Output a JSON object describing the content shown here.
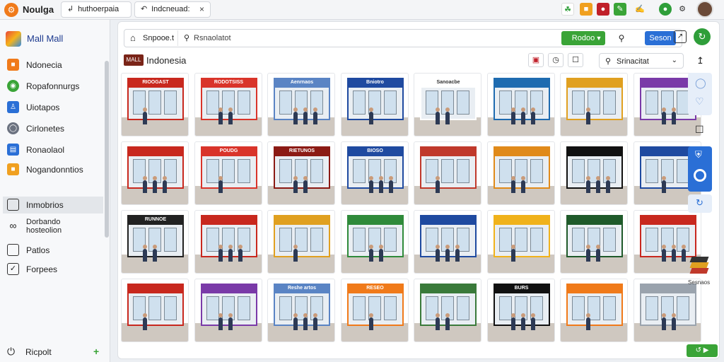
{
  "app": {
    "name": "Noulga"
  },
  "tabs": [
    {
      "label": "huthoerpaia"
    },
    {
      "label": "Indcneuad:"
    }
  ],
  "toolbar_icons": [
    {
      "icon": "leaf-icon",
      "color": "#2f9e3a"
    },
    {
      "icon": "square-icon",
      "color": "#f0a020"
    },
    {
      "icon": "record-icon",
      "color": "#c0202a"
    },
    {
      "icon": "edit-icon",
      "color": "#3aa437"
    },
    {
      "icon": "pen-icon",
      "color": "#333333"
    },
    {
      "icon": "chat-icon",
      "color": "#2f9e3a"
    },
    {
      "icon": "settings-icon",
      "color": "#333333"
    }
  ],
  "sidebar": {
    "header": "Mall Mall",
    "items": [
      {
        "label": "Ndonecia",
        "icon": "orange-square-icon",
        "color": "#f07a1a"
      },
      {
        "label": "Ropafonnurgs",
        "icon": "globe-icon",
        "color": "#3aa437"
      },
      {
        "label": "Uiotapos",
        "icon": "user-icon",
        "color": "#2a6fd6"
      },
      {
        "label": "Cirlonetes",
        "icon": "circle-icon",
        "color": "#6b7280"
      },
      {
        "label": "Ronaolaol",
        "icon": "id-card-icon",
        "color": "#2a6fd6"
      },
      {
        "label": "Nogandonntios",
        "icon": "folder-icon",
        "color": "#f0a020"
      }
    ],
    "items2": [
      {
        "label": "Inmobrios",
        "icon": "monitor-icon"
      },
      {
        "label": "Dorbando\nhosteolion",
        "icon": "link-icon"
      },
      {
        "label": "Patlos",
        "icon": "page-icon"
      },
      {
        "label": "Forpees",
        "icon": "check-box-icon"
      }
    ],
    "footer": "Ricpolt",
    "footer_action": "+"
  },
  "main": {
    "breadcrumb": "Snpooe.t",
    "search_text": "Rsnaolatot",
    "green_button": "Rodoo",
    "blue_button": "Seson",
    "flag_text": "MALL",
    "title": "Indonesia",
    "dropdown_text": "Srinacitat",
    "right_rail_label": "Sesnaos"
  },
  "tiles": [
    {
      "sign": "RIOOGAST",
      "color": "#c8281e"
    },
    {
      "sign": "RODOTSISS",
      "color": "#d9342a"
    },
    {
      "sign": "Aenrnaos",
      "color": "#5a84c4"
    },
    {
      "sign": "Bniotro",
      "color": "#1f4aa0"
    },
    {
      "sign": "Sanoacbe",
      "color": "#ffffff"
    },
    {
      "sign": "",
      "color": "#1e6bb0"
    },
    {
      "sign": "",
      "color": "#e0a020"
    },
    {
      "sign": "",
      "color": "#7a3aa8"
    },
    {
      "sign": "",
      "color": "#c8281e"
    },
    {
      "sign": "POUDG",
      "color": "#d9342a"
    },
    {
      "sign": "RIETUNOS",
      "color": "#8b1a14"
    },
    {
      "sign": "BIOSO",
      "color": "#1f4aa0"
    },
    {
      "sign": "",
      "color": "#c0392b"
    },
    {
      "sign": "",
      "color": "#e08a1a"
    },
    {
      "sign": "",
      "color": "#111111"
    },
    {
      "sign": "",
      "color": "#1f4aa0"
    },
    {
      "sign": "RUNNOE",
      "color": "#222222"
    },
    {
      "sign": "",
      "color": "#c8281e"
    },
    {
      "sign": "",
      "color": "#e0a020"
    },
    {
      "sign": "",
      "color": "#2f8a3a"
    },
    {
      "sign": "",
      "color": "#1f4aa0"
    },
    {
      "sign": "",
      "color": "#f0b21b"
    },
    {
      "sign": "",
      "color": "#1f5a2a"
    },
    {
      "sign": "",
      "color": "#c8281e"
    },
    {
      "sign": "",
      "color": "#c8281e"
    },
    {
      "sign": "",
      "color": "#7a3aa8"
    },
    {
      "sign": "Reshe artos",
      "color": "#5a84c4"
    },
    {
      "sign": "RESEO",
      "color": "#f07a1a"
    },
    {
      "sign": "",
      "color": "#3a7a3a"
    },
    {
      "sign": "BURS",
      "color": "#111111"
    },
    {
      "sign": "",
      "color": "#f07a1a"
    },
    {
      "sign": "",
      "color": "#9aa3ad"
    }
  ]
}
